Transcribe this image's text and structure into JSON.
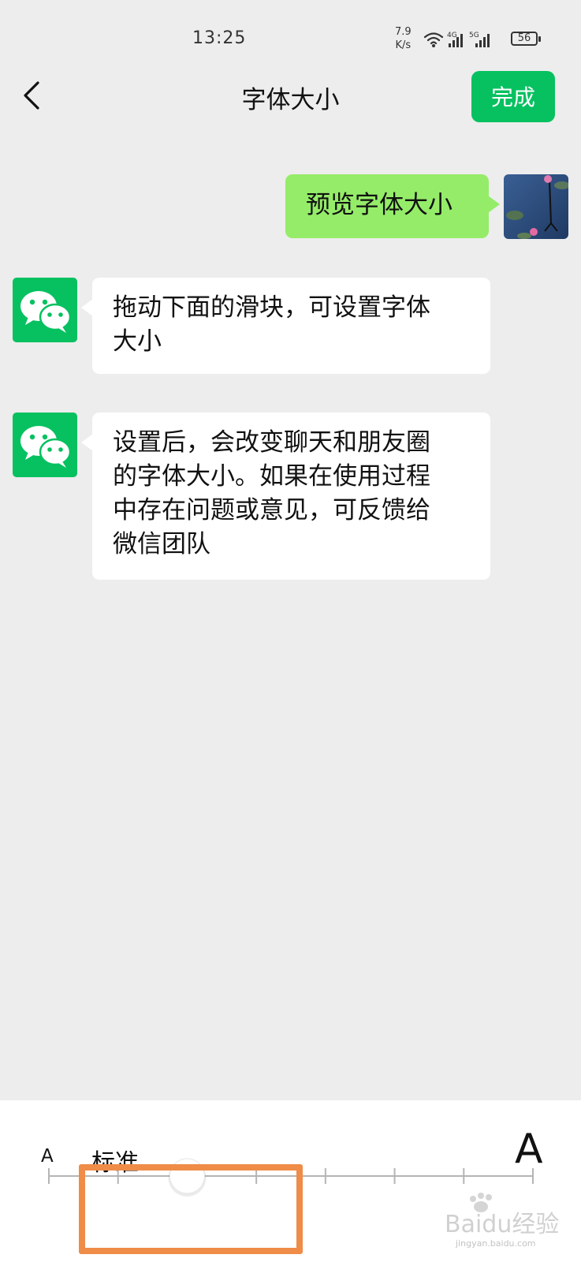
{
  "status_bar": {
    "time": "13:25",
    "net_speed_value": "7.9",
    "net_speed_unit": "K/s",
    "signal_1": "4G",
    "signal_2": "5G",
    "battery": "56"
  },
  "nav": {
    "title": "字体大小",
    "done_label": "完成"
  },
  "messages": [
    {
      "sender": "self",
      "text": "预览字体大小"
    },
    {
      "sender": "wechat",
      "lines": [
        "拖动下面的滑块，可设置字体",
        "大小"
      ]
    },
    {
      "sender": "wechat",
      "lines": [
        "设置后，会改变聊天和朋友圈",
        "的字体大小。如果在使用过程",
        "中存在问题或意见，可反馈给",
        "微信团队"
      ]
    }
  ],
  "font_slider": {
    "small_label": "A",
    "large_label": "A",
    "current_label": "标准",
    "stops": 8,
    "selected_index": 2
  },
  "watermark": {
    "brand": "Baidu经验",
    "url": "jingyan.baidu.com"
  },
  "colors": {
    "accent": "#07c160",
    "self_bubble": "#95ec69",
    "background": "#ededed",
    "highlight": "#ef8c47"
  },
  "icons": [
    "back-icon",
    "wifi-icon",
    "signal-icon",
    "battery-icon",
    "wechat-logo-icon"
  ]
}
